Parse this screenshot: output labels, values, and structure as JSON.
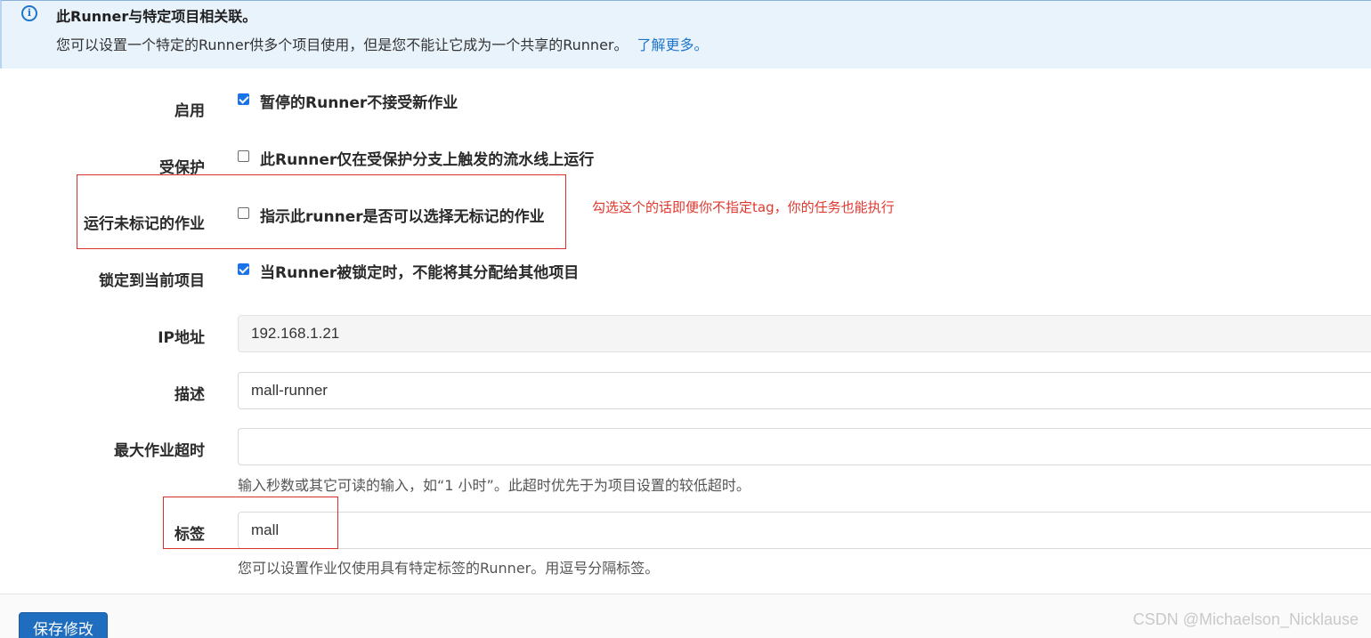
{
  "banner": {
    "title": "此Runner与特定项目相关联。",
    "body": "您可以设置一个特定的Runner供多个项目使用，但是您不能让它成为一个共享的Runner。",
    "link": "了解更多。"
  },
  "form": {
    "active": {
      "label": "启用",
      "checkbox_text": "暂停的Runner不接受新作业",
      "checked": true
    },
    "protected": {
      "label": "受保护",
      "checkbox_text": "此Runner仅在受保护分支上触发的流水线上运行",
      "checked": false
    },
    "run_untagged": {
      "label": "运行未标记的作业",
      "checkbox_text": "指示此runner是否可以选择无标记的作业",
      "checked": false
    },
    "locked": {
      "label": "锁定到当前项目",
      "checkbox_text": "当Runner被锁定时，不能将其分配给其他项目",
      "checked": true
    },
    "ip_address": {
      "label": "IP地址",
      "value": "192.168.1.21"
    },
    "description": {
      "label": "描述",
      "value": "mall-runner"
    },
    "max_timeout": {
      "label": "最大作业超时",
      "value": "",
      "help": "输入秒数或其它可读的输入，如“1 小时”。此超时优先于为项目设置的较低超时。"
    },
    "tags": {
      "label": "标签",
      "value": "mall",
      "help": "您可以设置作业仅使用具有特定标签的Runner。用逗号分隔标签。"
    }
  },
  "annotation": {
    "text": "勾选这个的话即便你不指定tag，你的任务也能执行",
    "color": "#e0382f"
  },
  "save_button": {
    "label": "保存修改",
    "color": "#1f6dbf"
  },
  "watermark": "CSDN @Michaelson_Nicklause"
}
